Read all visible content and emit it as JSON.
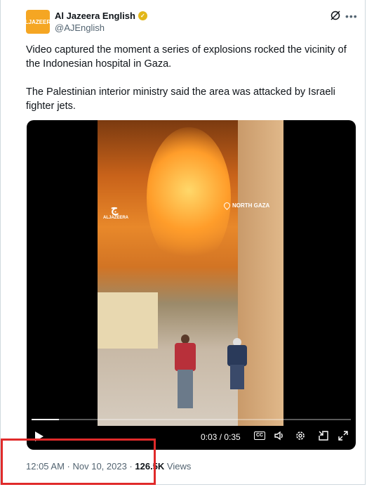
{
  "tweet": {
    "author": {
      "name": "Al Jazeera English",
      "handle": "@AJEnglish",
      "avatar_text": "ALJAZEERA",
      "verified_color": "#e2b719"
    },
    "text": {
      "paragraph_1": "Video captured the moment a series of explosions rocked the vicinity of the Indonesian hospital in Gaza.",
      "paragraph_2": "The Palestinian interior ministry said the area was attacked by Israeli fighter jets."
    },
    "video": {
      "location_label": "NORTH GAZA",
      "logo_text": "ALJAZEERA",
      "time": "0:03 / 0:35",
      "progress": 0.086,
      "cc_label": "CC"
    },
    "meta": {
      "time": "12:05 AM · Nov 10, 2023 · ",
      "views_count": "126.5K",
      "views_label": " Views"
    }
  },
  "icons": [
    "verified-badge-icon",
    "grok-icon",
    "more-icon",
    "location-pin-icon",
    "play-icon",
    "cc-icon",
    "volume-icon",
    "gear-icon",
    "pip-icon",
    "fullscreen-icon"
  ],
  "colors": {
    "highlight": "#e02a2a",
    "text_secondary": "#536471",
    "avatar_bg": "#f5a623"
  }
}
